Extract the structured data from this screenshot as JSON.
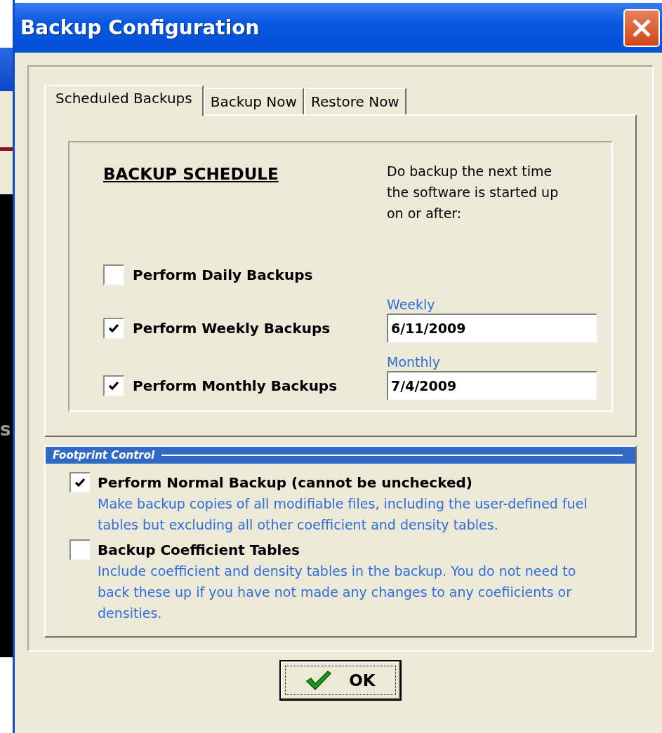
{
  "background_window": {
    "text": "s"
  },
  "window": {
    "title": "Backup Configuration"
  },
  "tabs": [
    {
      "label": "Scheduled Backups",
      "selected": true
    },
    {
      "label": "Backup Now",
      "selected": false
    },
    {
      "label": "Restore Now",
      "selected": false
    }
  ],
  "schedule": {
    "heading": "BACKUP SCHEDULE",
    "note": "Do backup the next time the software is started up on or after:",
    "options": [
      {
        "label": "Perform Daily Backups",
        "checked": false
      },
      {
        "label": "Perform Weekly Backups",
        "checked": true,
        "date_label": "Weekly",
        "date_value": "6/11/2009"
      },
      {
        "label": "Perform Monthly Backups",
        "checked": true,
        "date_label": "Monthly",
        "date_value": "7/4/2009"
      }
    ]
  },
  "footprint": {
    "title": "Footprint Control",
    "options": [
      {
        "label": "Perform Normal Backup (cannot be unchecked)",
        "checked": true,
        "description": "Make backup copies of all modifiable files, including the user-defined fuel tables but excluding all other coefficient and density tables."
      },
      {
        "label": "Backup Coefficient Tables",
        "checked": false,
        "description": "Include coefficient and density tables in the backup.  You do not need to back these up if you have not made any changes to any coefiicients or densities."
      }
    ]
  },
  "ok_button": {
    "label": "OK"
  }
}
